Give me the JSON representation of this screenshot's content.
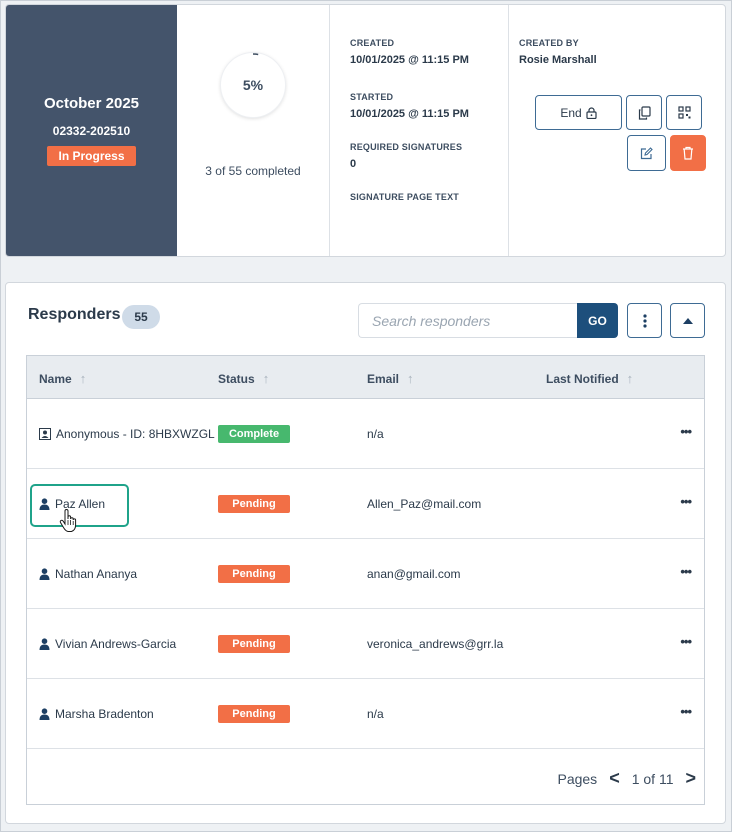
{
  "summary": {
    "title": "October 2025",
    "code": "02332-202510",
    "status": "In Progress",
    "progress_percent": 5,
    "progress_label": "5%",
    "progress_text": "3 of 55 completed",
    "created_label": "CREATED",
    "created_value": "10/01/2025 @ 11:15 PM",
    "started_label": "STARTED",
    "started_value": "10/01/2025 @ 11:15 PM",
    "required_signatures_label": "REQUIRED SIGNATURES",
    "required_signatures_value": "0",
    "signature_page_text_label": "SIGNATURE PAGE TEXT",
    "created_by_label": "CREATED BY",
    "created_by_value": "Rosie Marshall"
  },
  "actions": {
    "end_label": "End",
    "icons": [
      "lock-icon",
      "copy-icon",
      "qr-code-icon",
      "edit-icon",
      "trash-icon"
    ]
  },
  "responders": {
    "title": "Responders",
    "count": "55",
    "search_placeholder": "Search responders",
    "go_label": "GO",
    "columns": [
      "Name",
      "Status",
      "Email",
      "Last Notified"
    ],
    "rows": [
      {
        "name": "Anonymous - ID: 8HBXWZGL",
        "status": "Complete",
        "email": "n/a",
        "icon": "anonymous-icon"
      },
      {
        "name": "Paz Allen",
        "status": "Pending",
        "email": "Allen_Paz@mail.com",
        "icon": "user-icon"
      },
      {
        "name": "Nathan Ananya",
        "status": "Pending",
        "email": "anan@gmail.com",
        "icon": "user-icon"
      },
      {
        "name": "Vivian Andrews-Garcia",
        "status": "Pending",
        "email": "veronica_andrews@grr.la",
        "icon": "user-icon"
      },
      {
        "name": "Marsha Bradenton",
        "status": "Pending",
        "email": "n/a",
        "icon": "user-icon"
      }
    ],
    "pager": {
      "label": "Pages",
      "current": "1 of 11"
    }
  },
  "colors": {
    "sidebar": "#44546b",
    "accent_orange": "#f26f46",
    "complete_green": "#47b86e",
    "primary_blue": "#1d4f7c",
    "highlight_teal": "#1fa38a"
  }
}
